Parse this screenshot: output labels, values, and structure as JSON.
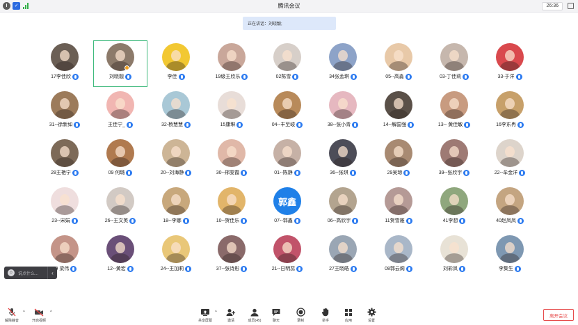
{
  "window": {
    "title": "腾讯会议",
    "timer": "26:36",
    "icons": [
      "info-icon",
      "shield-icon",
      "signal-icon",
      "maximize-icon"
    ]
  },
  "speaking_bar": "正在讲话：刘晓靓;",
  "participants": [
    {
      "name": "17李佳欣",
      "color": "#6b5f55"
    },
    {
      "name": "刘晓靓",
      "color": "#8c7a6a",
      "active": true
    },
    {
      "name": "李佳",
      "color": "#f2c832"
    },
    {
      "name": "19级王欣乐",
      "color": "#c9a79a"
    },
    {
      "name": "02陈雪",
      "color": "#d7cfc9"
    },
    {
      "name": "34张孟琪",
      "color": "#8da3c8"
    },
    {
      "name": "05--高淼",
      "color": "#e8c9a8"
    },
    {
      "name": "03-丁佳莉",
      "color": "#c6b7ad"
    },
    {
      "name": "33-于洋",
      "color": "#d9494d"
    },
    {
      "name": "31--徐新如",
      "color": "#9c7b5b"
    },
    {
      "name": "王佳宁_",
      "color": "#f1b6b2"
    },
    {
      "name": "32-杨慧慧",
      "color": "#a9c8d6"
    },
    {
      "name": "15康琳",
      "color": "#e8ddd8"
    },
    {
      "name": "04--丰至峻",
      "color": "#b88a5a"
    },
    {
      "name": "38--张小青",
      "color": "#e6b8c0"
    },
    {
      "name": "14--解国强",
      "color": "#5a5048"
    },
    {
      "name": "13-- 黄佳敏",
      "color": "#c89b80"
    },
    {
      "name": "16李东冉",
      "color": "#c7a06a"
    },
    {
      "name": "28王艳宁",
      "color": "#7d6a58"
    },
    {
      "name": "09 何璐",
      "color": "#b07a4f"
    },
    {
      "name": "20--刘海静",
      "color": "#cdb596"
    },
    {
      "name": "30--邢雯霞",
      "color": "#e0b8a8"
    },
    {
      "name": "01--陈静",
      "color": "#c6b1a6"
    },
    {
      "name": "36--张琪",
      "color": "#4d4d58"
    },
    {
      "name": "29吴琼",
      "color": "#a88a72"
    },
    {
      "name": "39--张欣宇",
      "color": "#9e7a74"
    },
    {
      "name": "22--牟金洋",
      "color": "#ddd4cb"
    },
    {
      "name": "23--宋娟",
      "color": "#efdede"
    },
    {
      "name": "26--王文英",
      "color": "#d2cac4"
    },
    {
      "name": "18--李娜",
      "color": "#c8a87c"
    },
    {
      "name": "10--贺佳乐",
      "color": "#e2b56a"
    },
    {
      "name": "07--郭鑫",
      "color": "#1f80e8",
      "text": "郭鑫"
    },
    {
      "name": "06--高欣宇",
      "color": "#b3a48f"
    },
    {
      "name": "11贺雪雅",
      "color": "#b59a96"
    },
    {
      "name": "41李想",
      "color": "#8fa77d"
    },
    {
      "name": "40赵凤凤",
      "color": "#c4a581"
    },
    {
      "name": "19 梁伟",
      "color": "#c49488"
    },
    {
      "name": "12--黄宏",
      "color": "#6a4f78"
    },
    {
      "name": "24--王加莉",
      "color": "#e9c778"
    },
    {
      "name": "37--张诗彤",
      "color": "#8a6a6a"
    },
    {
      "name": "21--日明蕊",
      "color": "#c1536a"
    },
    {
      "name": "27王晓皓",
      "color": "#9aa6b4"
    },
    {
      "name": "08郭云阁",
      "color": "#a9b7c8"
    },
    {
      "name": "刘彩凤",
      "color": "#e8e2d6"
    },
    {
      "name": "李集生",
      "color": "#7e98b2"
    }
  ],
  "chat": {
    "placeholder": "说点什么...",
    "icon": "smiley-icon",
    "collapse": "chevron-left-icon"
  },
  "toolbar": {
    "mute_label": "解除静音",
    "video_label": "开启视频",
    "share_label": "共享屏幕",
    "invite_label": "邀请",
    "members_label": "成员(45)",
    "chat_label": "聊天",
    "record_label": "录制",
    "hand_label": "举手",
    "apps_label": "应用",
    "settings_label": "设置",
    "leave_label": "离开会议"
  }
}
